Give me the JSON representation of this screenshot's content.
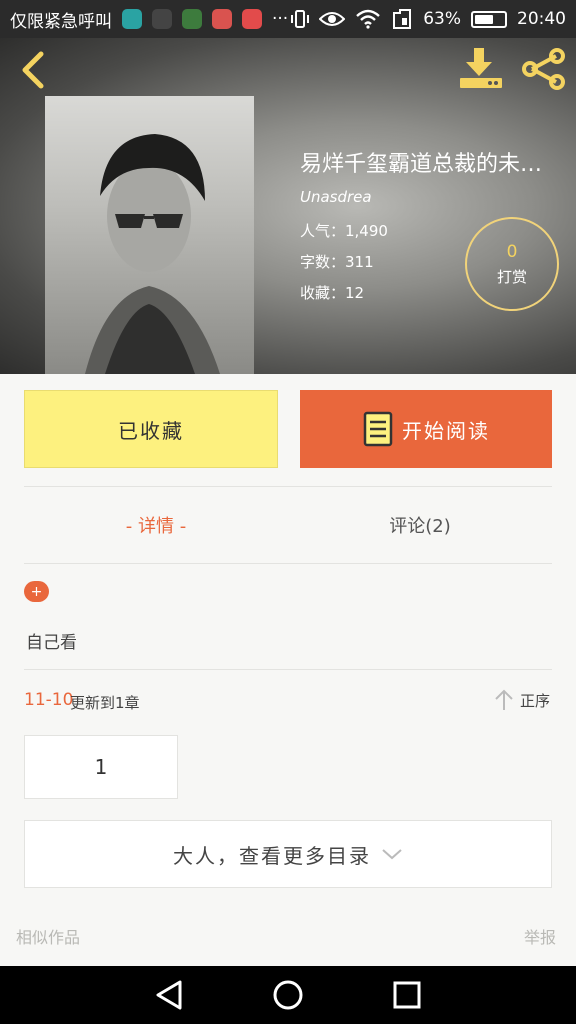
{
  "status_bar": {
    "carrier": "仅限紧急呼叫",
    "signal_dots": "···",
    "battery_percent": "63%",
    "battery_level": 0.63,
    "time": "20:40"
  },
  "header": {
    "back_icon": "chevron-left-icon",
    "download_icon": "download-icon",
    "share_icon": "share-icon"
  },
  "book": {
    "title": "易烊千玺霸道总裁的未…",
    "author": "Unasdrea",
    "popularity": "人气：1,490",
    "word_count": "字数：311",
    "favorites": "收藏：12",
    "reward_count": "0",
    "reward_label": "打赏"
  },
  "actions": {
    "collect_label": "已收藏",
    "read_label": "开始阅读"
  },
  "tabs": {
    "detail": "- 详情 -",
    "comments": "评论(2)"
  },
  "details": {
    "plus_label": "+",
    "tag_text": "自己看",
    "update_date": "11-10",
    "update_text": "更新到1章",
    "sort_label": "正序",
    "chapter_number": "1",
    "more_catalog": "大人，查看更多目录"
  },
  "footer": {
    "similar_label": "相似作品",
    "report_label": "举报"
  },
  "colors": {
    "accent": "#e9673c",
    "collect_bg": "#fdf17f",
    "reward_border": "#f1d37a"
  }
}
